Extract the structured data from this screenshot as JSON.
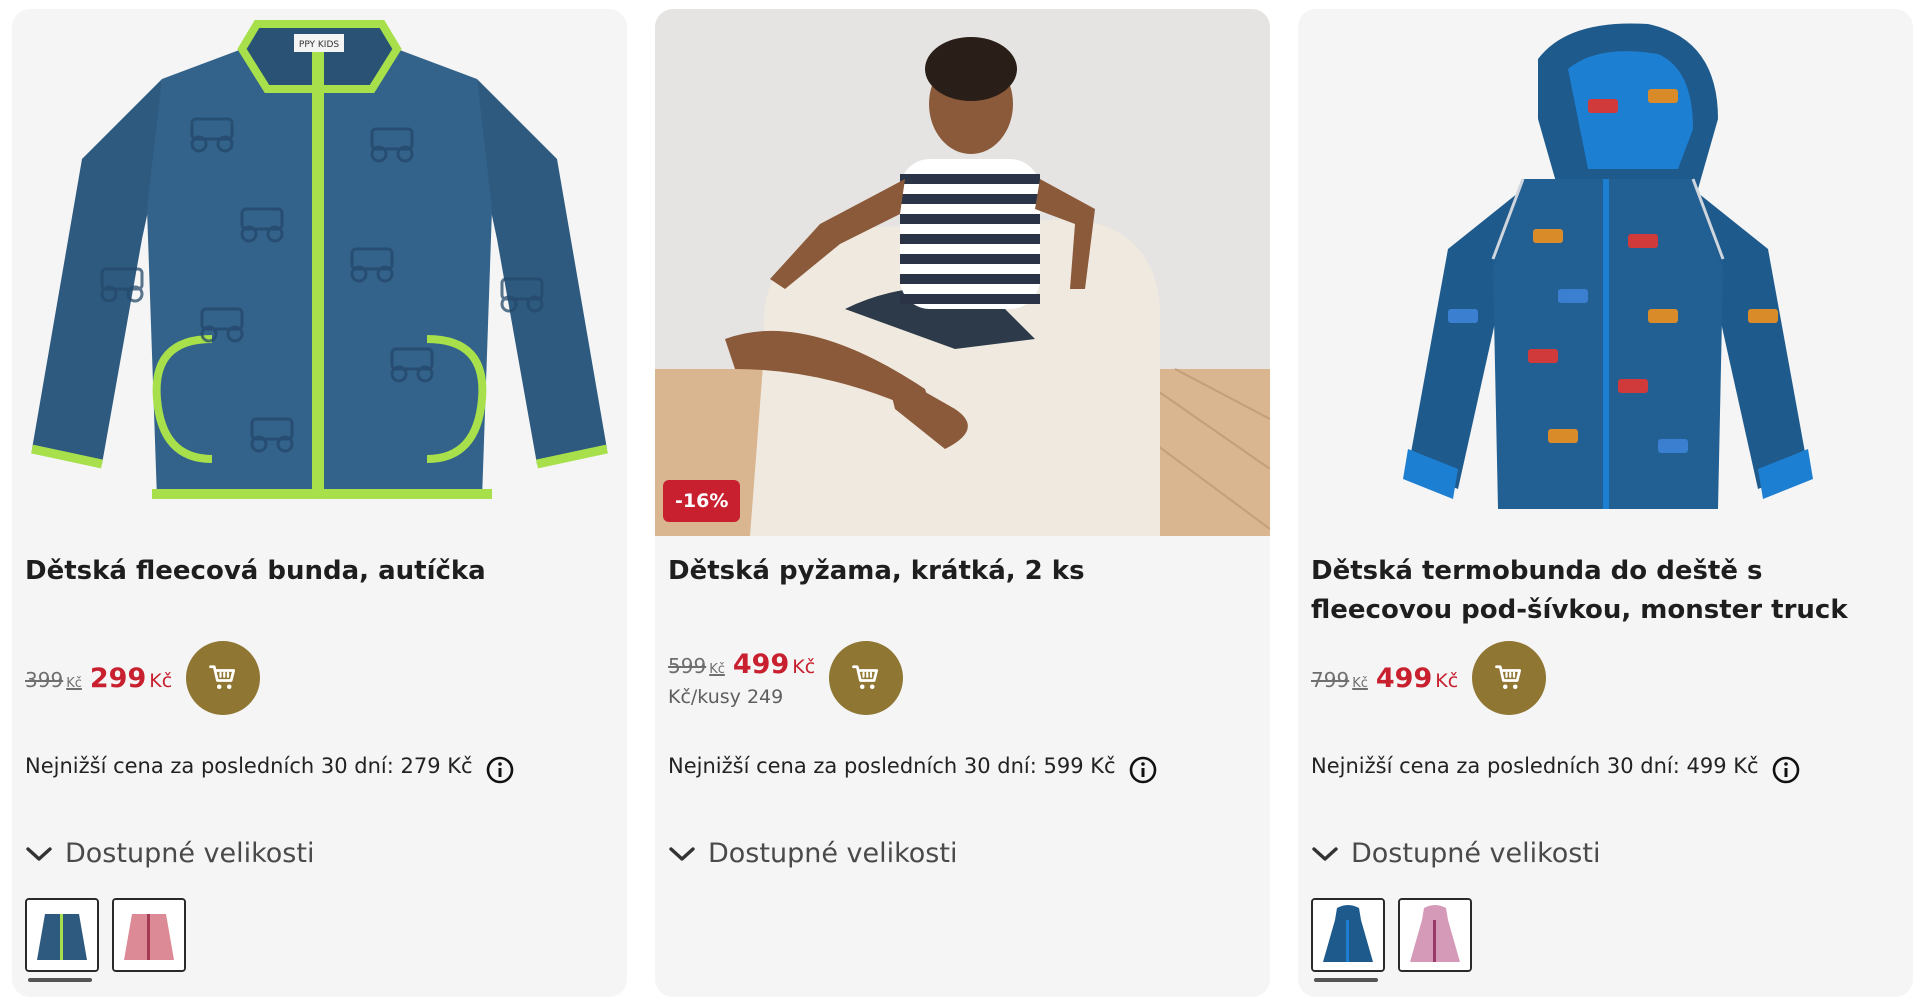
{
  "products": [
    {
      "title": "Dětská fleecová bunda, autíčka",
      "old_price": "399",
      "new_price": "299",
      "currency": "Kč",
      "unit_price": "",
      "discount": "",
      "lowest_price_text": "Nejnižší cena za posledních 30 dní: 279 Kč",
      "sizes_label": "Dostupné velikosti",
      "swatches": [
        "navy-blue",
        "pink-floral"
      ],
      "image_label": "PPY KIDS"
    },
    {
      "title": "Dětská pyžama, krátká, 2 ks",
      "old_price": "599",
      "new_price": "499",
      "currency": "Kč",
      "unit_price": "Kč/kusy 249",
      "discount": "-16%",
      "lowest_price_text": "Nejnižší cena za posledních 30 dní: 599 Kč",
      "sizes_label": "Dostupné velikosti",
      "swatches": []
    },
    {
      "title": "Dětská termobunda do deště s fleecovou pod-šívkou, monster truck",
      "old_price": "799",
      "new_price": "499",
      "currency": "Kč",
      "unit_price": "",
      "discount": "",
      "lowest_price_text": "Nejnižší cena za posledních 30 dní: 499 Kč",
      "sizes_label": "Dostupné velikosti",
      "swatches": [
        "navy-blue",
        "pink-floral"
      ]
    }
  ],
  "colors": {
    "card_bg": "#f5f5f5",
    "sale_red": "#c8202f",
    "cart_gold": "#8f7632",
    "jacket_blue": "#2d5a7e",
    "accent_lime": "#a8e04b"
  },
  "icons": {
    "cart": "shopping-cart-icon",
    "info": "info-icon",
    "chevron": "chevron-down-icon"
  }
}
